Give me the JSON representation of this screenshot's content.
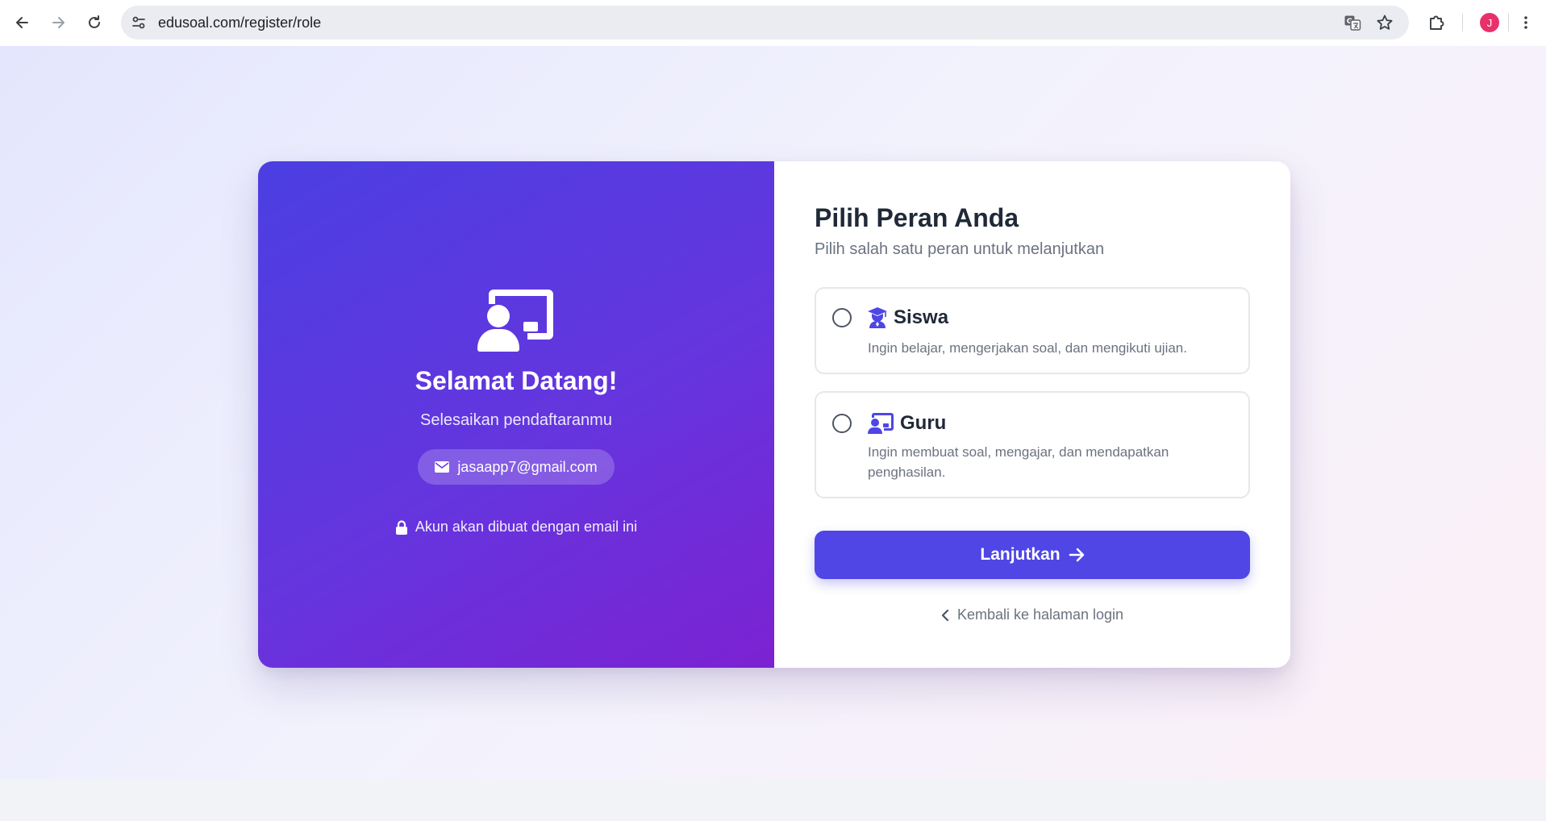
{
  "browser": {
    "url": "edusoal.com/register/role",
    "profile_initial": "J"
  },
  "hero": {
    "title": "Selamat Datang!",
    "subtitle": "Selesaikan pendaftaranmu",
    "email": "jasaapp7@gmail.com",
    "notice": "Akun akan dibuat dengan email ini"
  },
  "form": {
    "title": "Pilih Peran Anda",
    "subtitle": "Pilih salah satu peran untuk melanjutkan",
    "roles": [
      {
        "name": "Siswa",
        "description": "Ingin belajar, mengerjakan soal, dan mengikuti ujian.",
        "icon": "graduate-icon",
        "selected": false
      },
      {
        "name": "Guru",
        "description": "Ingin membuat soal, mengajar, dan mendapatkan penghasilan.",
        "icon": "teacher-icon",
        "selected": false
      }
    ],
    "continue_label": "Lanjutkan",
    "back_label": "Kembali ke halaman login"
  },
  "colors": {
    "accent": "#4f46e5",
    "gradient_start": "#4b3fe2",
    "gradient_end": "#7c22d2",
    "avatar": "#e8316b"
  }
}
